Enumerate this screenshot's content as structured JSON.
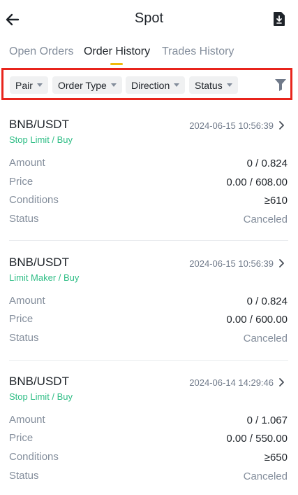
{
  "header": {
    "title": "Spot",
    "back_icon": "arrow-left-icon",
    "export_icon": "download-document-icon"
  },
  "tabs": [
    {
      "label": "Open Orders",
      "active": false
    },
    {
      "label": "Order History",
      "active": true
    },
    {
      "label": "Trades History",
      "active": false
    }
  ],
  "filters": {
    "chips": [
      "Pair",
      "Order Type",
      "Direction",
      "Status"
    ],
    "filter_icon": "funnel-icon"
  },
  "orders": [
    {
      "pair": "BNB/USDT",
      "type": "Stop Limit / Buy",
      "time": "2024-06-15 10:56:39",
      "rows": [
        {
          "label": "Amount",
          "value": "0 / 0.824"
        },
        {
          "label": "Price",
          "value": "0.00 / 608.00"
        },
        {
          "label": "Conditions",
          "value": "≥610"
        },
        {
          "label": "Status",
          "value": "Canceled"
        }
      ]
    },
    {
      "pair": "BNB/USDT",
      "type": "Limit Maker / Buy",
      "time": "2024-06-15 10:56:39",
      "rows": [
        {
          "label": "Amount",
          "value": "0 / 0.824"
        },
        {
          "label": "Price",
          "value": "0.00 / 600.00"
        },
        {
          "label": "Status",
          "value": "Canceled"
        }
      ]
    },
    {
      "pair": "BNB/USDT",
      "type": "Stop Limit / Buy",
      "time": "2024-06-14 14:29:46",
      "rows": [
        {
          "label": "Amount",
          "value": "0 / 1.067"
        },
        {
          "label": "Price",
          "value": "0.00 / 550.00"
        },
        {
          "label": "Conditions",
          "value": "≥650"
        },
        {
          "label": "Status",
          "value": "Canceled"
        }
      ]
    }
  ],
  "colors": {
    "accent": "#f0b90b",
    "buy_green": "#2ebd85",
    "highlight_border": "#e8241c",
    "muted_text": "#848e9c"
  }
}
